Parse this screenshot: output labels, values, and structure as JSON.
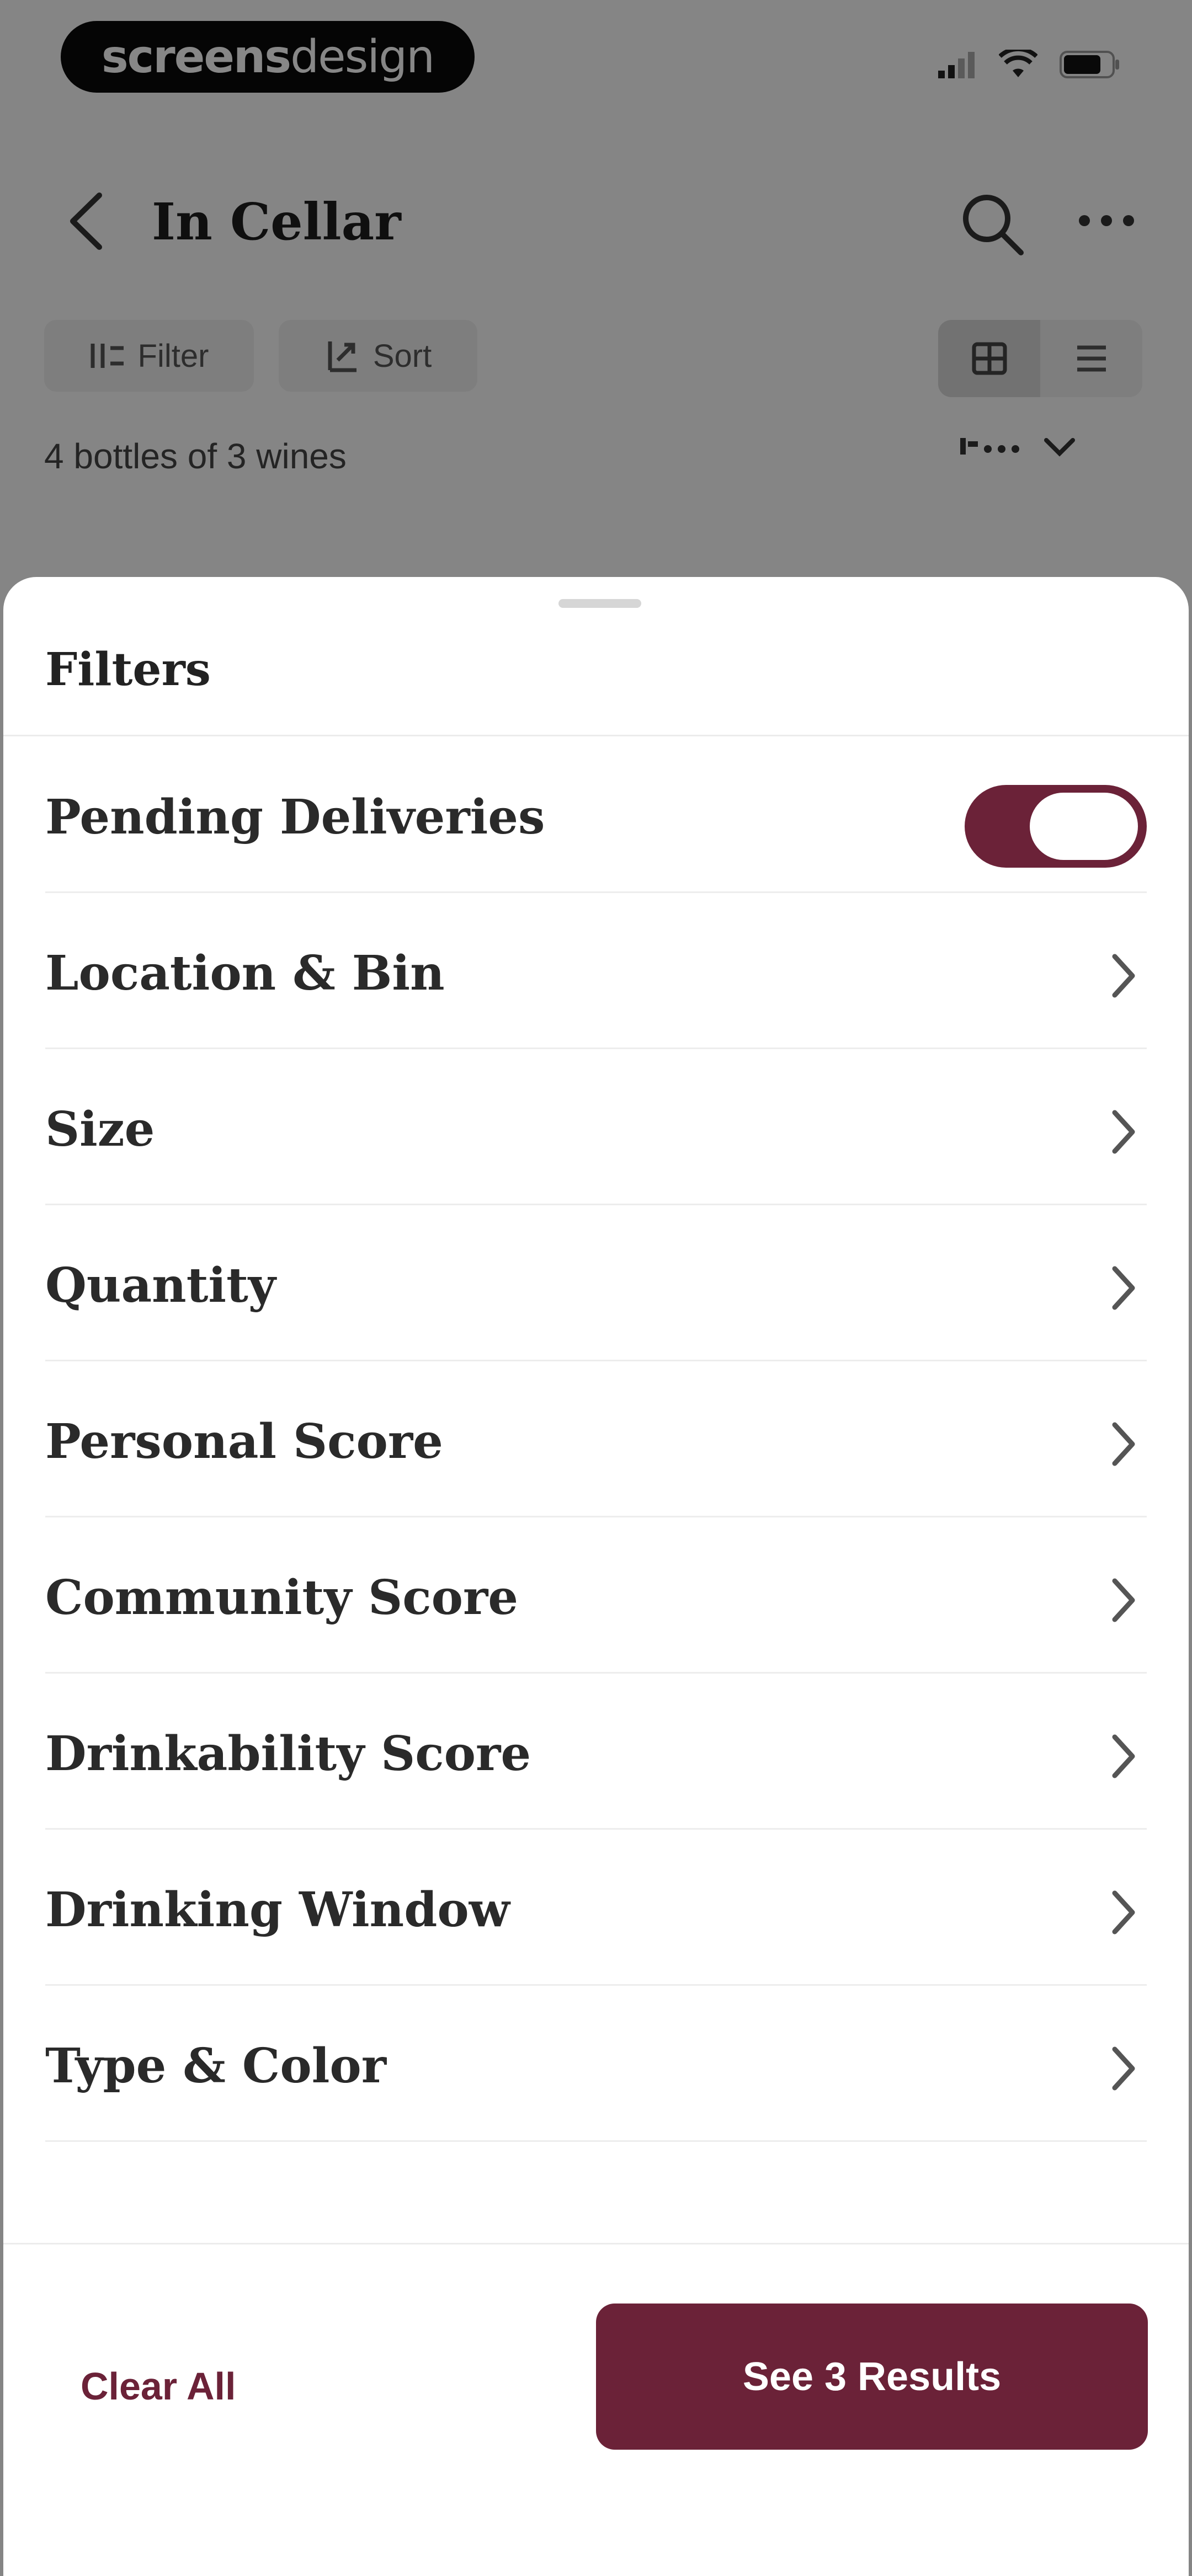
{
  "status_bar": {
    "brand_bold": "screens",
    "brand_light": "design"
  },
  "nav": {
    "title": "In Cellar"
  },
  "toolbar": {
    "filter_label": "Filter",
    "sort_label": "Sort"
  },
  "summary": {
    "count_text": "4 bottles of 3 wines"
  },
  "sheet": {
    "title": "Filters",
    "items": [
      {
        "label": "Pending Deliveries",
        "control": "toggle",
        "on": true
      },
      {
        "label": "Location & Bin",
        "control": "chevron"
      },
      {
        "label": "Size",
        "control": "chevron"
      },
      {
        "label": "Quantity",
        "control": "chevron"
      },
      {
        "label": "Personal Score",
        "control": "chevron"
      },
      {
        "label": "Community Score",
        "control": "chevron"
      },
      {
        "label": "Drinkability Score",
        "control": "chevron"
      },
      {
        "label": "Drinking Window",
        "control": "chevron"
      },
      {
        "label": "Type & Color",
        "control": "chevron"
      }
    ],
    "clear_label": "Clear All",
    "results_label": "See 3 Results"
  },
  "colors": {
    "accent": "#6b2238",
    "scrim": "#000000"
  },
  "icons": [
    "back-arrow-icon",
    "search-icon",
    "more-icon",
    "filter-icon",
    "sort-icon",
    "grid-view-icon",
    "list-view-icon",
    "chevron-right-icon",
    "chevron-down-icon"
  ]
}
